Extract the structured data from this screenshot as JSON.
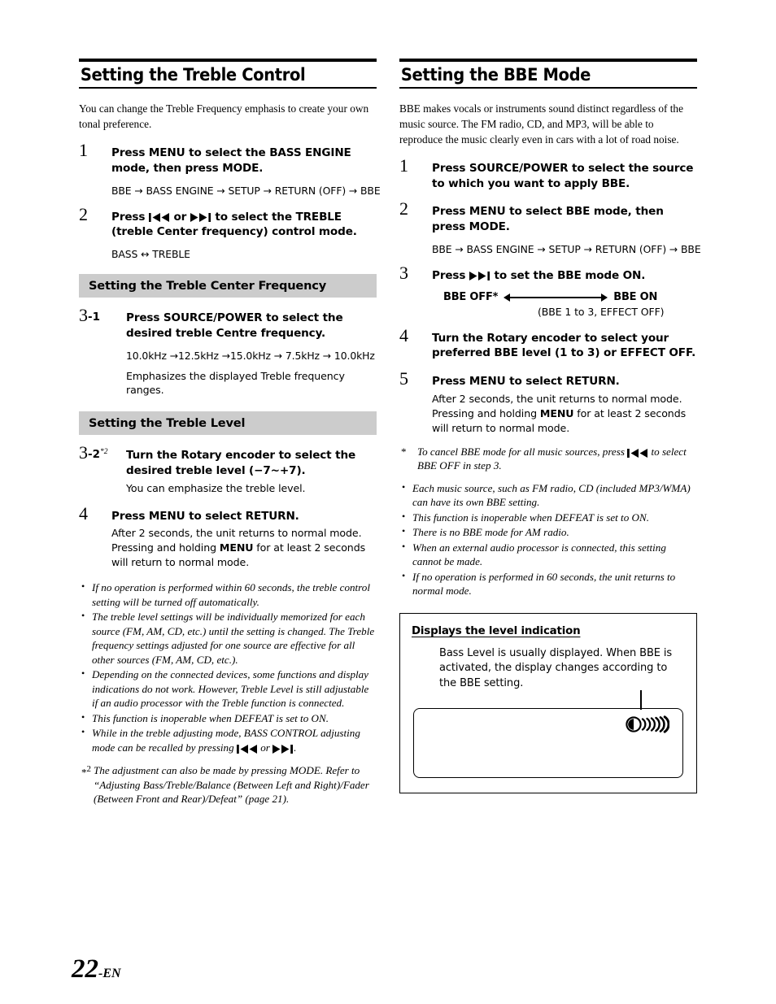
{
  "page": {
    "folio_number": "22",
    "folio_suffix": "-EN"
  },
  "left_column": {
    "section_title": "Setting the Treble Control",
    "intro": "You can change the Treble Frequency emphasis to create your own tonal preference.",
    "step1": {
      "num": "1",
      "title_a": "Press ",
      "title_b": "MENU",
      "title_c": " to select the BASS ENGINE mode, then press ",
      "title_d": "MODE",
      "title_e": ".",
      "flow": "BBE → BASS ENGINE → SETUP → RETURN (OFF) → BBE"
    },
    "step2": {
      "num": "2",
      "title_a": "Press ",
      "title_b": " or ",
      "title_c": " to select the TREBLE (treble Center frequency) control mode.",
      "flow": "BASS ↔ TREBLE"
    },
    "band1": "Setting the Treble Center Frequency",
    "step3_1": {
      "num": "3",
      "sub": "-1",
      "title_a": "Press ",
      "title_b": "SOURCE/POWER",
      "title_c": " to select the desired treble Centre frequency.",
      "flow": "10.0kHz →12.5kHz →15.0kHz → 7.5kHz → 10.0kHz",
      "body": "Emphasizes the displayed Treble frequency ranges."
    },
    "band2": "Setting the Treble Level",
    "step3_2": {
      "num": "3",
      "sub": "-2",
      "sup": "*2",
      "title_a": "Turn the ",
      "title_b": "Rotary encoder",
      "title_c": " to select the desired treble level (−7~+7).",
      "body": "You can emphasize the treble level."
    },
    "step4": {
      "num": "4",
      "title_a": "Press ",
      "title_b": "MENU",
      "title_c": " to select RETURN.",
      "body_line1": "After 2 seconds, the unit returns to normal mode.",
      "body_line2a": "Pressing and holding ",
      "body_line2b": "MENU",
      "body_line2c": " for at least 2 seconds will return to normal mode."
    },
    "notes": [
      "If no operation is performed within 60 seconds, the treble control setting will be turned off automatically.",
      "The treble level settings will be individually memorized for each source (FM, AM, CD, etc.) until the setting is changed. The Treble frequency settings adjusted for one source are effective for all other sources (FM, AM, CD, etc.).",
      "Depending on the connected devices, some functions and display indications do not work. However, Treble Level is still adjustable if an audio processor with the Treble function is connected.",
      "This function is inoperable when DEFEAT is set to ON."
    ],
    "note_with_glyphs": {
      "text_a": "While in the treble adjusting mode, BASS CONTROL adjusting mode can be recalled by pressing ",
      "text_b": " or ",
      "text_c": "."
    },
    "footnote2": {
      "marker": "*",
      "marker_sup": "2",
      "text_a": " The adjustment can also be made by pressing ",
      "text_b": "MODE",
      "text_c": ". Refer to “Adjusting Bass/Treble/Balance (Between Left and Right)/Fader (Between Front and Rear)/Defeat” (page 21)."
    }
  },
  "right_column": {
    "section_title": "Setting the BBE Mode",
    "intro": "BBE makes vocals or instruments sound distinct regardless of the music source. The FM radio, CD, and MP3, will be able to reproduce the music clearly even in cars with a lot of road noise.",
    "step1": {
      "num": "1",
      "title_a": "Press ",
      "title_b": "SOURCE/POWER",
      "title_c": " to select the source to which you want to apply BBE."
    },
    "step2": {
      "num": "2",
      "title_a": "Press ",
      "title_b": "MENU",
      "title_c": " to select BBE mode, then press ",
      "title_d": "MODE",
      "title_e": ".",
      "flow": "BBE → BASS ENGINE → SETUP → RETURN (OFF) → BBE"
    },
    "step3": {
      "num": "3",
      "title_a": "Press ",
      "title_b": " to set the BBE mode ON.",
      "diagram_left": "BBE OFF*",
      "diagram_right": "BBE ON",
      "diagram_sub": "(BBE 1 to 3, EFFECT OFF)"
    },
    "step4": {
      "num": "4",
      "title_a": "Turn the ",
      "title_b": "Rotary encoder",
      "title_c": " to select your preferred BBE level (1 to 3) or EFFECT OFF."
    },
    "step5": {
      "num": "5",
      "title_a": "Press ",
      "title_b": "MENU",
      "title_c": " to select RETURN.",
      "body_line1": "After 2 seconds, the unit returns to normal mode.",
      "body_line2a": "Pressing and holding ",
      "body_line2b": "MENU",
      "body_line2c": " for at least 2 seconds will return to normal mode."
    },
    "footnote_star": {
      "marker": "*",
      "text_a": "To cancel BBE mode for all music sources, press ",
      "text_b": " to select BBE OFF in step 3."
    },
    "notes": [
      "Each music source, such as FM radio, CD (included MP3/WMA) can have its own BBE setting.",
      "This function is inoperable when DEFEAT is set to ON.",
      "There is no BBE mode for AM radio.",
      "When an external audio processor is connected, this setting cannot be made.",
      "If no operation is performed in 60 seconds, the unit returns to normal mode."
    ],
    "display_box": {
      "title": "Displays the level indication",
      "text": "Bass Level is usually displayed. When BBE is activated, the display changes according to the BBE setting."
    }
  },
  "colors": {
    "band_gray": "#cccccc",
    "ink": "#000000",
    "paper": "#ffffff"
  }
}
